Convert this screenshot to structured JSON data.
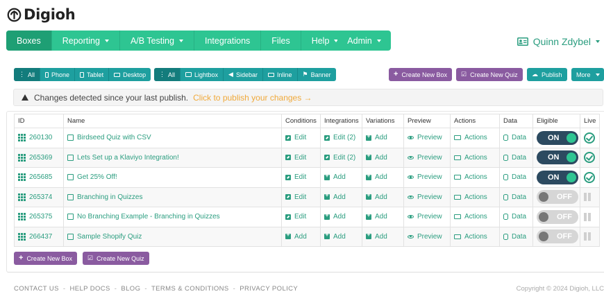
{
  "logo": {
    "text": "Digioh"
  },
  "nav": {
    "items": [
      {
        "label": "Boxes",
        "caret": false
      },
      {
        "label": "Reporting",
        "caret": true
      },
      {
        "label": "A/B Testing",
        "caret": true
      },
      {
        "label": "Integrations",
        "caret": false
      },
      {
        "label": "Files",
        "caret": false
      },
      {
        "label": "Help",
        "caret": true
      }
    ],
    "admin_label": "Admin"
  },
  "user": {
    "name": "Quinn Zdybel"
  },
  "device_filters": [
    {
      "label": "All",
      "icon": "all-icon"
    },
    {
      "label": "Phone",
      "icon": "phone-icon"
    },
    {
      "label": "Tablet",
      "icon": "tablet-icon"
    },
    {
      "label": "Desktop",
      "icon": "desktop-icon"
    }
  ],
  "type_filters": [
    {
      "label": "All",
      "icon": "all-icon"
    },
    {
      "label": "Lightbox",
      "icon": "lightbox-icon"
    },
    {
      "label": "Sidebar",
      "icon": "sidebar-icon"
    },
    {
      "label": "Inline",
      "icon": "inline-icon"
    },
    {
      "label": "Banner",
      "icon": "banner-icon"
    }
  ],
  "actions": {
    "create_box": "Create New Box",
    "create_quiz": "Create New Quiz",
    "publish": "Publish",
    "more": "More"
  },
  "alert": {
    "message": "Changes detected since your last publish.",
    "link": "Click to publish your changes →"
  },
  "table": {
    "headers": [
      "ID",
      "Name",
      "Conditions",
      "Integrations",
      "Variations",
      "Preview",
      "Actions",
      "Data",
      "Eligible",
      "Live"
    ],
    "rows": [
      {
        "id": "260130",
        "name": "Birdseed Quiz with CSV",
        "conditions": "Edit",
        "integrations": "Edit (2)",
        "variations": "Add",
        "preview": "Preview",
        "actions": "Actions",
        "data": "Data",
        "eligible": "ON",
        "live": true
      },
      {
        "id": "265369",
        "name": "Lets Set up a Klaviyo Integration!",
        "conditions": "Edit",
        "integrations": "Edit (2)",
        "variations": "Add",
        "preview": "Preview",
        "actions": "Actions",
        "data": "Data",
        "eligible": "ON",
        "live": true
      },
      {
        "id": "265685",
        "name": "Get 25% Off!",
        "conditions": "Edit",
        "integrations": "Add",
        "variations": "Add",
        "preview": "Preview",
        "actions": "Actions",
        "data": "Data",
        "eligible": "ON",
        "live": true
      },
      {
        "id": "265374",
        "name": "Branching in Quizzes",
        "conditions": "Edit",
        "integrations": "Add",
        "variations": "Add",
        "preview": "Preview",
        "actions": "Actions",
        "data": "Data",
        "eligible": "OFF",
        "live": false
      },
      {
        "id": "265375",
        "name": "No Branching Example - Branching in Quizzes",
        "conditions": "Edit",
        "integrations": "Add",
        "variations": "Add",
        "preview": "Preview",
        "actions": "Actions",
        "data": "Data",
        "eligible": "OFF",
        "live": false
      },
      {
        "id": "266437",
        "name": "Sample Shopify Quiz",
        "conditions": "Add",
        "integrations": "Add",
        "variations": "Add",
        "preview": "Preview",
        "actions": "Actions",
        "data": "Data",
        "eligible": "OFF",
        "live": false
      }
    ]
  },
  "footer": {
    "links": [
      "CONTACT US",
      "HELP DOCS",
      "BLOG",
      "TERMS & CONDITIONS",
      "PRIVACY POLICY"
    ],
    "copyright": "Copyright © 2024 Digioh, LLC"
  },
  "colors": {
    "primary": "#2ec592",
    "teal": "#1e9f9f",
    "purple": "#8a5ba0",
    "link": "#2a9d7f",
    "publish_link": "#f0a93a",
    "toggle_on": "#2c4a60"
  }
}
